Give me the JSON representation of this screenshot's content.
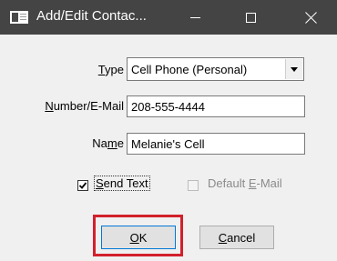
{
  "window": {
    "title": "Add/Edit Contac...",
    "icon": "app-window-icon"
  },
  "titlebar_buttons": {
    "minimize": "minimize-icon",
    "maximize": "maximize-icon",
    "close": "close-icon"
  },
  "form": {
    "type": {
      "label_first": "T",
      "label_rest": "ype",
      "selected_value": "Cell Phone (Personal)"
    },
    "number": {
      "label_first": "N",
      "label_rest": "umber/E-Mail",
      "value": "208-555-4444"
    },
    "name": {
      "label_pre": "Na",
      "label_u": "m",
      "label_rest": "e",
      "value": "Melanie's Cell"
    },
    "send_text": {
      "label_first": "S",
      "label_rest": "end Text",
      "checked": true
    },
    "default_email": {
      "label_pre": "Default ",
      "label_u": "E",
      "label_rest": "-Mail",
      "checked": false,
      "enabled": false
    }
  },
  "buttons": {
    "ok_u": "O",
    "ok_rest": "K",
    "cancel_u": "C",
    "cancel_rest": "ancel"
  },
  "colors": {
    "titlebar": "#444444",
    "highlight": "#d2202c",
    "focus_border": "#0078d7"
  }
}
